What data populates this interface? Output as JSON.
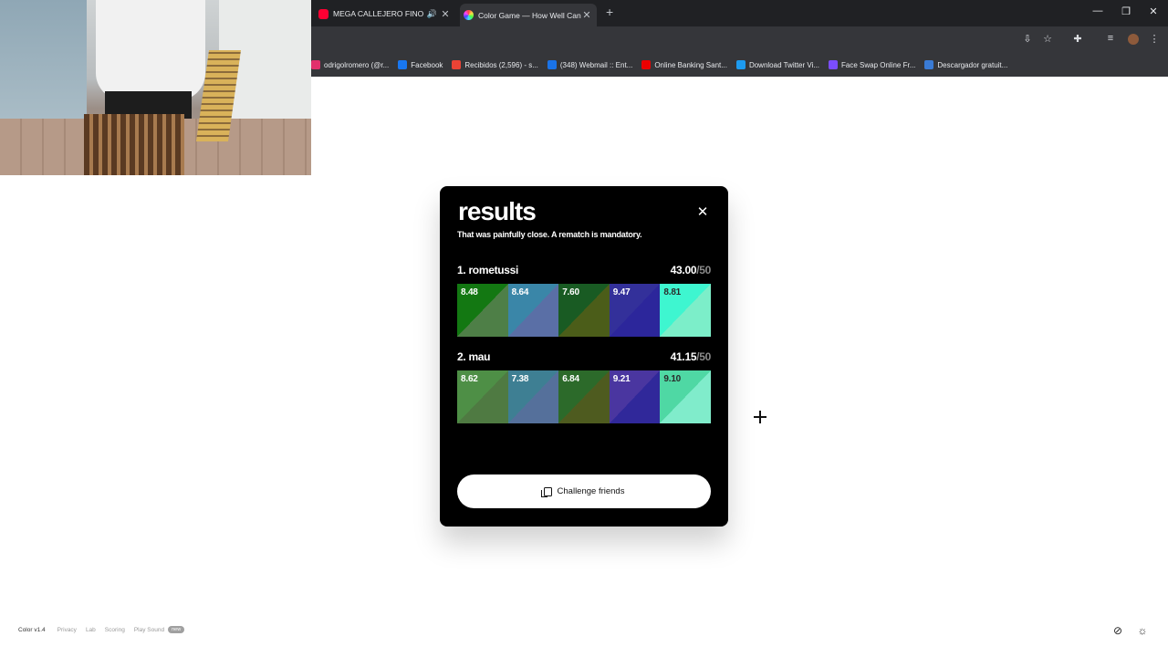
{
  "browser": {
    "tabs": [
      {
        "title": "MEGA CALLEJERO FINO R(",
        "favicon": "youtube-icon",
        "audio": true
      },
      {
        "title": "Color Game — How Well Can Y",
        "favicon": "color-game-icon",
        "active": true
      }
    ],
    "bookmarks": [
      {
        "label": "odrigolromero (@r...",
        "color": "#e1306c"
      },
      {
        "label": "Facebook",
        "color": "#1877f2"
      },
      {
        "label": "Recibidos (2,596) - s...",
        "color": "#ea4335"
      },
      {
        "label": "(348) Webmail :: Ent...",
        "color": "#1a73e8"
      },
      {
        "label": "Online Banking Sant...",
        "color": "#ec0000"
      },
      {
        "label": "Download Twitter Vi...",
        "color": "#1d9bf0"
      },
      {
        "label": "Face Swap Online Fr...",
        "color": "#7b4dff"
      },
      {
        "label": "Descargador gratuit...",
        "color": "#3a7bd5"
      }
    ]
  },
  "modal": {
    "title": "results",
    "subtitle": "That was painfully close. A rematch is mandatory.",
    "players": [
      {
        "name": "1. rometussi",
        "score": "43.00",
        "max": "/50",
        "swatches": [
          {
            "value": "8.48",
            "target": "#137812",
            "guess": "#4e7f47",
            "text": "#ffffff"
          },
          {
            "value": "8.64",
            "target": "#3a86a8",
            "guess": "#5a6fa6",
            "text": "#ffffff"
          },
          {
            "value": "7.60",
            "target": "#195b23",
            "guess": "#4b5d19",
            "text": "#ffffff"
          },
          {
            "value": "9.47",
            "target": "#33309a",
            "guess": "#2c269b",
            "text": "#ffffff"
          },
          {
            "value": "8.81",
            "target": "#3ef6d0",
            "guess": "#7ceec9",
            "text": "#2a2a2a"
          }
        ]
      },
      {
        "name": "2. mau",
        "score": "41.15",
        "max": "/50",
        "swatches": [
          {
            "value": "8.62",
            "target": "#4e8f46",
            "guess": "#4f7a42",
            "text": "#ffffff"
          },
          {
            "value": "7.38",
            "target": "#3e7f93",
            "guess": "#55709b",
            "text": "#ffffff"
          },
          {
            "value": "6.84",
            "target": "#2c6a2a",
            "guess": "#4e5b1f",
            "text": "#ffffff"
          },
          {
            "value": "9.21",
            "target": "#4a36a0",
            "guess": "#30289a",
            "text": "#ffffff"
          },
          {
            "value": "9.10",
            "target": "#4fd8a4",
            "guess": "#80eccb",
            "text": "#2a2a2a"
          }
        ]
      }
    ],
    "challenge_label": "Challenge friends"
  },
  "footer": {
    "brand": "Color v1.4",
    "links": [
      "Privacy",
      "Lab",
      "Scoring",
      "Play Sound"
    ],
    "badge": "new"
  }
}
